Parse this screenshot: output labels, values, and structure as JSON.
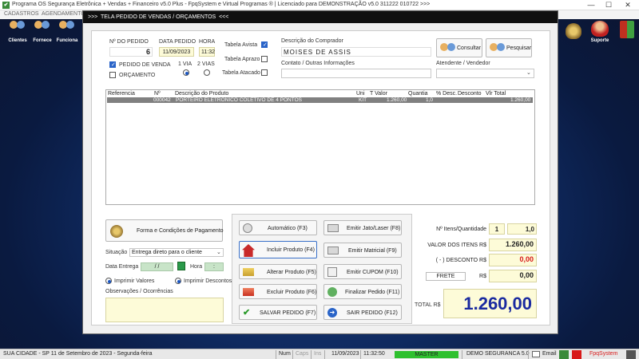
{
  "titlebar": {
    "text": "Programa OS Segurança Eletrônica + Vendas + Financeiro v5.0 Plus - FpqSystem e Virtual Programas ® | Licenciado para  DEMONSTRAÇÃO v5.0 311222 010722 >>>",
    "minimize": "—",
    "maximize": "☐",
    "close": "✕"
  },
  "menubar": [
    "CADASTROS",
    "AGENDAMENTO"
  ],
  "toolbar_left": [
    {
      "label": "Clientes",
      "icon": "clientes-icon"
    },
    {
      "label": "Fornece",
      "icon": "fornecedores-icon"
    },
    {
      "label": "Funciona",
      "icon": "funcionarios-icon"
    }
  ],
  "toolbar_right": [
    {
      "label": "",
      "icon": "coin-icon"
    },
    {
      "label": "Suporte",
      "icon": "suporte-icon"
    },
    {
      "label": "",
      "icon": "exit-icon"
    }
  ],
  "dialog": {
    "title": ">>>  TELA PEDIDO DE VENDAS / ORÇAMENTOS  <<<",
    "numero_pedido_label": "Nº DO PEDIDO",
    "numero_pedido": "6",
    "data_pedido_label": "DATA PEDIDO",
    "data_pedido": "11/09/2023",
    "hora_label": "HORA",
    "hora": "11:32",
    "tabela_avista": "Tabela Avista",
    "tabela_aprazo": "Tabela Aprazo",
    "tabela_atacado": "Tabela Atacado",
    "pedido_venda_label": "PEDIDO DE VENDA",
    "orcamento_label": "ORÇAMENTO",
    "via1": "1 VIA",
    "via2": "2 VIAS",
    "comprador_label": "Descrição do Comprador",
    "comprador": "MOISES DE ASSIS",
    "contato_label": "Contato / Outras Informações",
    "contato": "",
    "atendente_label": "Atendente / Vendedor",
    "atendente": "",
    "consultar_button": "Consultar",
    "pesquisar_button": "Pesquisar"
  },
  "grid": {
    "columns": [
      "Referencia",
      "Nº",
      "Descrição do Produto",
      "Uni",
      "T Valor",
      "Quantia",
      "% Desc.",
      "Desconto",
      "Vlr Total"
    ],
    "rows": [
      {
        "referencia": "",
        "numero": "000042",
        "descricao": "PORTEIRO ELETRÔNICO COLETIVO DE 4 PONTOS",
        "uni": "KIT",
        "valor": "1.260,00",
        "quantia": "1,0",
        "perc_desc": "",
        "desconto": "",
        "total": "1.260,00"
      }
    ]
  },
  "left_panel": {
    "forma_button": "Forma e Condições de Pagamento",
    "situacao_label": "Situação",
    "situacao": "Entrega direto para o cliente",
    "data_entrega_label": "Data Entrega",
    "data_entrega": "/ /",
    "hora_label": "Hora",
    "hora": ":",
    "imprimir_valores": "Imprimir Valores",
    "imprimir_descontos": "Imprimir Descontos",
    "observacoes_label": "Observações / Ocorrências",
    "observacoes": ""
  },
  "actions": {
    "automatico": "Automático     (F3)",
    "incluir": "Incluir Produto  (F4)",
    "alterar": "Alterar Produto  (F5)",
    "excluir": "Excluir Produto  (F6)",
    "salvar": "SALVAR PEDIDO  (F7)",
    "emitir_jato": "Emitir Jato/Laser  (F8)",
    "emitir_matricial": "Emitir Matricial  (F9)",
    "emitir_cupom": "Emitir CUPOM   (F10)",
    "finalizar": "Finalizar Pedido  (F11)",
    "sair": "SAIR  PEDIDO  (F12)"
  },
  "summary": {
    "itens_label": "Nº Itens/Quantidade",
    "itens": "1",
    "quantidade": "1,0",
    "valor_itens_label": "VALOR DOS ITENS R$",
    "valor_itens": "1.260,00",
    "desconto_label": "( - ) DESCONTO R$",
    "desconto": "0,00",
    "frete_label": "FRETE",
    "frete_currency": "R$",
    "frete": "0,00",
    "total_label": "TOTAL R$",
    "total": "1.260,00"
  },
  "statusbar": {
    "cidade": "SUA CIDADE - SP 11 de Setembro de 2023 - Segunda-feira",
    "num": "Num",
    "caps": "Caps",
    "ins": "Ins",
    "data": "11/09/2023",
    "hora": "11:32:50",
    "usuario": "MASTER",
    "empresa": "DEMO SEGURANCA 5.0",
    "email": "Email",
    "brand": "FpqSystem"
  },
  "colors": {
    "accent_red": "#d81a1a",
    "dialog_title_bg": "#101010",
    "yellow_field": "#fdfbd8",
    "status_green": "#2ec02e"
  }
}
